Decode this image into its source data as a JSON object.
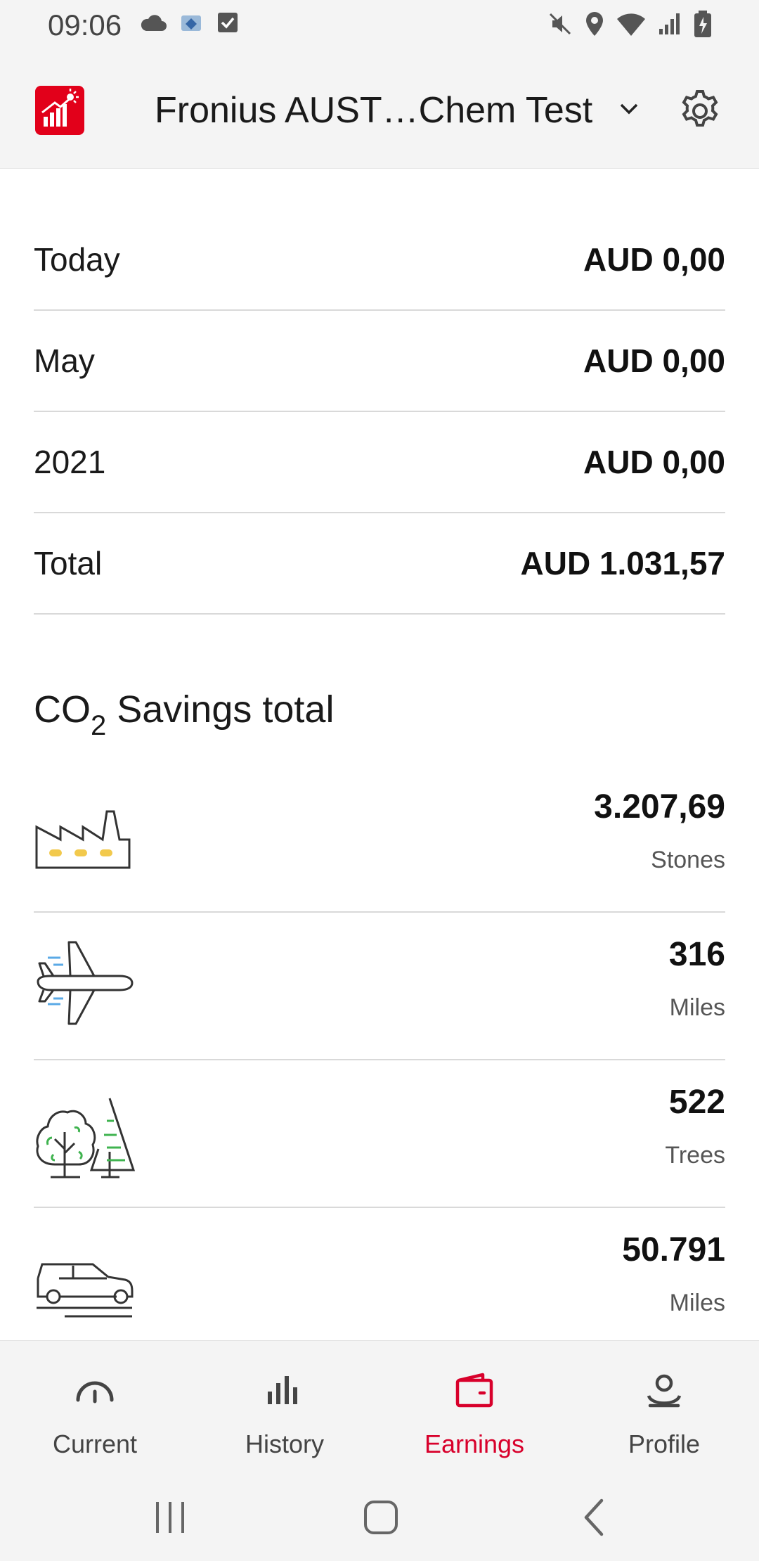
{
  "status_bar": {
    "time": "09:06"
  },
  "app_bar": {
    "title": "Fronius AUST…Chem Test"
  },
  "earnings": {
    "rows": [
      {
        "label": "Today",
        "value": "AUD 0,00"
      },
      {
        "label": "May",
        "value": "AUD 0,00"
      },
      {
        "label": "2021",
        "value": "AUD 0,00"
      },
      {
        "label": "Total",
        "value": "AUD 1.031,57"
      }
    ]
  },
  "co2": {
    "heading_prefix": "CO",
    "heading_sub": "2",
    "heading_suffix": " Savings total",
    "items": [
      {
        "icon": "factory-icon",
        "value": "3.207,69",
        "unit": "Stones"
      },
      {
        "icon": "airplane-icon",
        "value": "316",
        "unit": "Miles"
      },
      {
        "icon": "trees-icon",
        "value": "522",
        "unit": "Trees"
      },
      {
        "icon": "car-icon",
        "value": "50.791",
        "unit": "Miles"
      }
    ]
  },
  "bottom_nav": {
    "items": [
      {
        "label": "Current",
        "icon": "gauge-icon"
      },
      {
        "label": "History",
        "icon": "bar-chart-icon"
      },
      {
        "label": "Earnings",
        "icon": "wallet-icon"
      },
      {
        "label": "Profile",
        "icon": "profile-icon"
      }
    ],
    "active": "Earnings"
  },
  "colors": {
    "accent": "#e2001a",
    "active_nav": "#d8002b",
    "divider": "#d9d9d9",
    "factory_lights": "#f2c94c",
    "tree_leaves": "#3fb34f",
    "plane_speedlines": "#5aa9e6"
  }
}
